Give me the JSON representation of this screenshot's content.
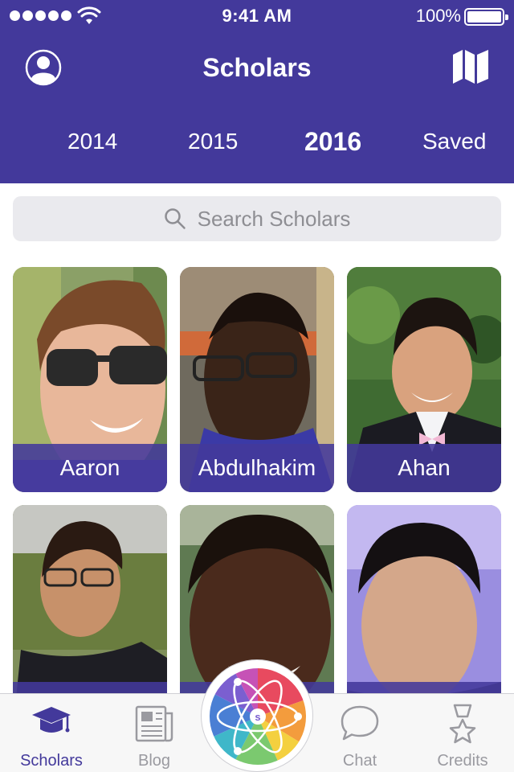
{
  "status": {
    "time": "9:41 AM",
    "battery": "100%"
  },
  "header": {
    "title": "Scholars"
  },
  "years": [
    {
      "label": "2014",
      "active": false
    },
    {
      "label": "2015",
      "active": false
    },
    {
      "label": "2016",
      "active": true
    },
    {
      "label": "Saved",
      "active": false
    }
  ],
  "search": {
    "placeholder": "Search Scholars"
  },
  "scholars": [
    {
      "name": "Aaron"
    },
    {
      "name": "Abdulhakim"
    },
    {
      "name": "Ahan"
    },
    {
      "name": ""
    },
    {
      "name": ""
    },
    {
      "name": ""
    }
  ],
  "tabbar": {
    "items": [
      {
        "label": "Scholars",
        "icon": "graduation-cap-icon",
        "active": true
      },
      {
        "label": "Blog",
        "icon": "newspaper-icon",
        "active": false
      },
      {
        "label": "Chat",
        "icon": "chat-bubble-icon",
        "active": false
      },
      {
        "label": "Credits",
        "icon": "medal-icon",
        "active": false
      }
    ]
  },
  "colors": {
    "brand": "#43399b",
    "tab_inactive": "#9a9aa0",
    "search_bg": "#eaeaee"
  }
}
